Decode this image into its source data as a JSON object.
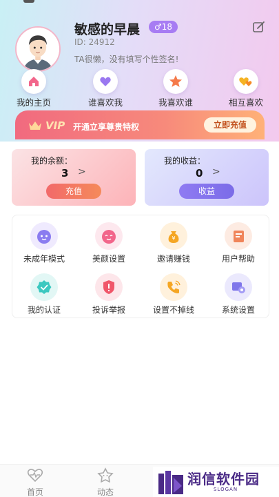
{
  "profile": {
    "nickname": "敏感的早晨",
    "badge": "♂18",
    "uid": "ID: 24912",
    "signature": "TA很懒，没有填写个性签名!"
  },
  "quick_links": [
    {
      "label": "我的主页",
      "icon": "home-icon"
    },
    {
      "label": "谁喜欢我",
      "icon": "heart-icon"
    },
    {
      "label": "我喜欢谁",
      "icon": "star-icon"
    },
    {
      "label": "相互喜欢",
      "icon": "mutual-hearts-icon"
    }
  ],
  "vip": {
    "tag": "VIP",
    "text": "开通立享尊贵特权",
    "button": "立即充值"
  },
  "balance": {
    "title": "我的余额：",
    "value": "3",
    "arrow": ">",
    "button": "充值"
  },
  "income": {
    "title": "我的收益：",
    "value": "0",
    "arrow": ">",
    "button": "收益"
  },
  "menu": [
    {
      "label": "未成年模式",
      "icon": "child-face-icon",
      "color": "#8a7cf0"
    },
    {
      "label": "美颜设置",
      "icon": "beauty-face-icon",
      "color": "#f2668b"
    },
    {
      "label": "邀请赚钱",
      "icon": "money-bag-icon",
      "color": "#f5a623"
    },
    {
      "label": "用户帮助",
      "icon": "help-book-icon",
      "color": "#f0845a"
    },
    {
      "label": "我的认证",
      "icon": "verified-badge-icon",
      "color": "#3cc8c0"
    },
    {
      "label": "投诉举报",
      "icon": "report-shield-icon",
      "color": "#f0566a"
    },
    {
      "label": "设置不掉线",
      "icon": "phone-call-icon",
      "color": "#f5a623"
    },
    {
      "label": "系统设置",
      "icon": "settings-icon",
      "color": "#7f76ea"
    }
  ],
  "tabs": [
    {
      "label": "首页",
      "icon": "home-wave-icon"
    },
    {
      "label": "动态",
      "icon": "moments-star-icon"
    }
  ],
  "brand": {
    "name": "润信软件园",
    "slogan": "SLOGAN"
  },
  "colors": {
    "accent_purple": "#a77cf3",
    "vip_gradient_start": "#f16a7f",
    "vip_gradient_end": "#ffb178"
  }
}
